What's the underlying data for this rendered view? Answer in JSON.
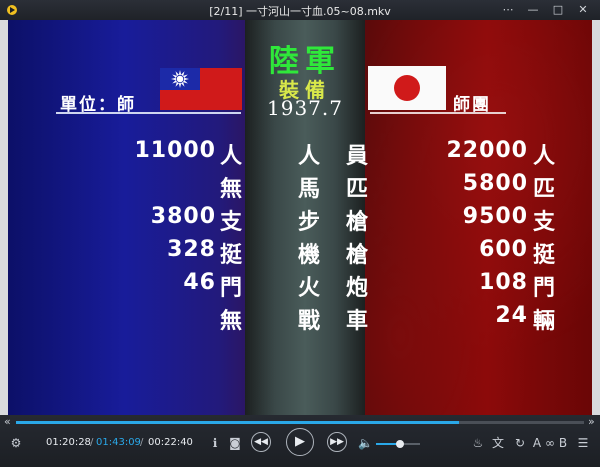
{
  "window": {
    "title": "[2/11] 一寸河山一寸血.05~08.mkv"
  },
  "titlebar_buttons": [
    "pin-icon",
    "minimize-icon",
    "maximize-icon",
    "close-icon"
  ],
  "video": {
    "header": {
      "title": "陸軍",
      "subtitle": "裝備",
      "date": "1937.7"
    },
    "left": {
      "unit_label": "單位：師",
      "flag": "roc-flag"
    },
    "right": {
      "unit_label": "師團",
      "flag": "japan-flag"
    },
    "rows": [
      {
        "category": "人員",
        "left_value": "11000",
        "left_unit": "人",
        "right_value": "22000",
        "right_unit": "人"
      },
      {
        "category": "馬匹",
        "left_value": "",
        "left_unit": "無",
        "right_value": "5800",
        "right_unit": "匹"
      },
      {
        "category": "步槍",
        "left_value": "3800",
        "left_unit": "支",
        "right_value": "9500",
        "right_unit": "支"
      },
      {
        "category": "機槍",
        "left_value": "328",
        "left_unit": "挺",
        "right_value": "600",
        "right_unit": "挺"
      },
      {
        "category": "火炮",
        "left_value": "46",
        "left_unit": "門",
        "right_value": "108",
        "right_unit": "門"
      },
      {
        "category": "戰車",
        "left_value": "",
        "left_unit": "無",
        "right_value": "24",
        "right_unit": "輛"
      }
    ]
  },
  "controls": {
    "seek_progress": 0.78,
    "current_time": "01:20:28",
    "total_time": "01:43:09",
    "remaining_time": "00:22:40",
    "separator": "/",
    "volume_level": 0.55,
    "ab_label": "A",
    "ab_label2": "B",
    "colors": {
      "accent": "#2aa8e8",
      "green_title": "#2fe83a",
      "yellow_sub": "#d8e84a"
    }
  }
}
